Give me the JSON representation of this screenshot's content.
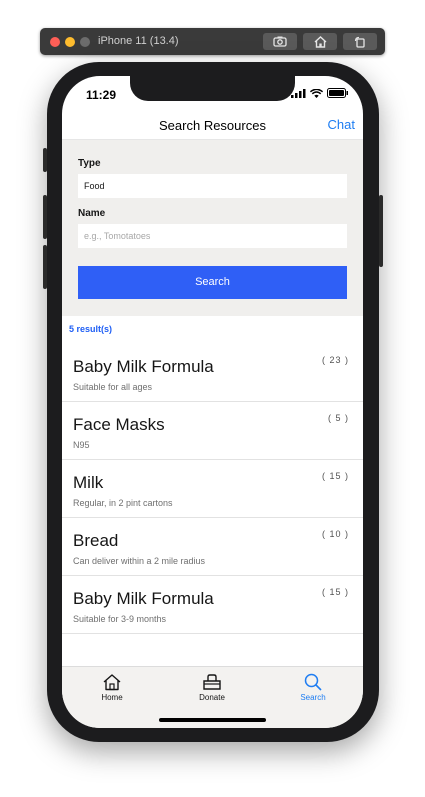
{
  "simulator": {
    "title": "iPhone 11 (13.4)",
    "buttons": [
      "screenshot-icon",
      "home-icon",
      "rotate-icon"
    ]
  },
  "status_bar": {
    "time": "11:29",
    "icons": [
      "signal-icon",
      "wifi-icon",
      "battery-icon"
    ]
  },
  "header": {
    "title": "Search Resources",
    "chat_label": "Chat"
  },
  "form": {
    "type_label": "Type",
    "type_value": "Food",
    "name_label": "Name",
    "name_placeholder": "e.g., Tomotatoes",
    "search_label": "Search"
  },
  "results": {
    "count_text": "5 result(s)",
    "items": [
      {
        "title": "Baby Milk Formula",
        "subtitle": "Suitable for all ages",
        "quantity": "( 23 )"
      },
      {
        "title": "Face Masks",
        "subtitle": "N95",
        "quantity": "( 5 )"
      },
      {
        "title": "Milk",
        "subtitle": "Regular, in 2 pint cartons",
        "quantity": "( 15 )"
      },
      {
        "title": "Bread",
        "subtitle": "Can deliver within a 2 mile radius",
        "quantity": "( 10 )"
      },
      {
        "title": "Baby Milk Formula",
        "subtitle": "Suitable for 3-9 months",
        "quantity": "( 15 )"
      }
    ]
  },
  "tab_bar": {
    "tabs": [
      {
        "label": "Home",
        "icon": "home-icon",
        "active": false
      },
      {
        "label": "Donate",
        "icon": "basket-icon",
        "active": false
      },
      {
        "label": "Search",
        "icon": "search-icon",
        "active": true
      }
    ],
    "active_color": "#1e7df2"
  },
  "colors": {
    "accent": "#2f5ff6",
    "link": "#1e7df2",
    "count": "#1e5ef5"
  }
}
